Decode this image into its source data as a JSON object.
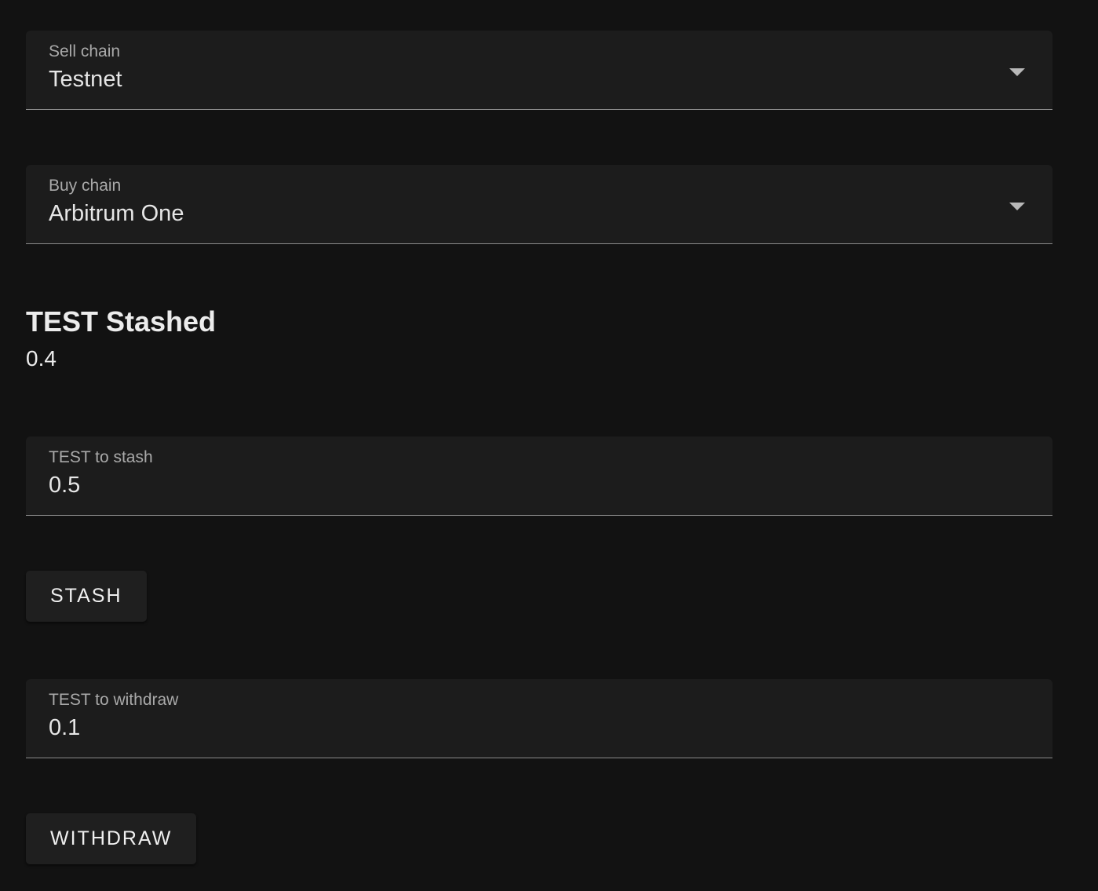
{
  "sell_chain": {
    "label": "Sell chain",
    "value": "Testnet",
    "icon": "chevron-down-icon"
  },
  "buy_chain": {
    "label": "Buy chain",
    "value": "Arbitrum One",
    "icon": "chevron-down-icon"
  },
  "stashed": {
    "title": "TEST Stashed",
    "value": "0.4"
  },
  "stash_input": {
    "label": "TEST to stash",
    "value": "0.5"
  },
  "stash_button": {
    "label": "STASH"
  },
  "withdraw_input": {
    "label": "TEST to withdraw",
    "value": "0.1"
  },
  "withdraw_button": {
    "label": "WITHDRAW"
  },
  "colors": {
    "background": "#121212",
    "field_background": "#1c1c1c",
    "label_text": "#a9a9a9",
    "value_text": "#e6e6e6",
    "underline": "#8a8a8a"
  }
}
